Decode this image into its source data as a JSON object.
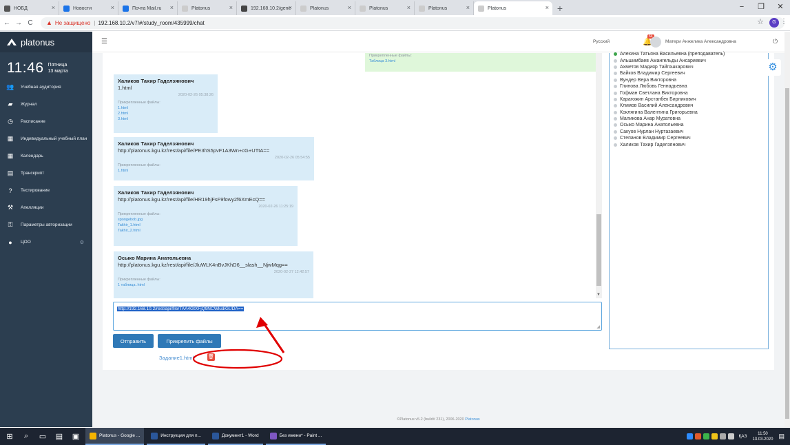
{
  "browser": {
    "tabs": [
      {
        "title": "НОБД",
        "color": "#555555"
      },
      {
        "title": "Новости",
        "color": "#1a73e8"
      },
      {
        "title": "Почта Mail.ru",
        "color": "#1a73e8"
      },
      {
        "title": "Platonus",
        "color": "#cccccc"
      },
      {
        "title": "192.168.10.2/generatr",
        "color": "#444444"
      },
      {
        "title": "Platonus",
        "color": "#cccccc"
      },
      {
        "title": "Platonus",
        "color": "#cccccc"
      },
      {
        "title": "Platonus",
        "color": "#cccccc"
      },
      {
        "title": "Platonus",
        "color": "#cccccc"
      }
    ],
    "new_tab": "+",
    "window_controls": {
      "minimize": "−",
      "maximize": "❐",
      "close": "✕"
    },
    "not_secure": "Не защищено",
    "url": "192.168.10.2/v7/#/study_room/435999/chat",
    "profile_initial": "G"
  },
  "sidebar": {
    "brand": "platonus",
    "time": "11:46",
    "weekday": "Пятница",
    "date": "13 марта",
    "items": [
      {
        "label": "Учебная аудитория",
        "icon": "people-icon"
      },
      {
        "label": "Журнал",
        "icon": "book-icon"
      },
      {
        "label": "Расписание",
        "icon": "clock-icon"
      },
      {
        "label": "Индивидуальный учебный план",
        "icon": "grid-icon"
      },
      {
        "label": "Календарь",
        "icon": "calendar-icon"
      },
      {
        "label": "Транскрипт",
        "icon": "table-icon"
      },
      {
        "label": "Тестирование",
        "icon": "question-icon"
      },
      {
        "label": "Апелляции",
        "icon": "gavel-icon"
      },
      {
        "label": "Параметры авторизации",
        "icon": "key-icon"
      },
      {
        "label": "ЦОО",
        "icon": "user-icon"
      }
    ]
  },
  "header": {
    "language": "Русский",
    "notifications": "64",
    "user": "Матери Анжелика Александровна"
  },
  "chat": {
    "messages": [
      {
        "author": "",
        "text": "",
        "timestamp": "",
        "attachments_label": "Прикрепленные файлы:",
        "files": [
          "Таблица 3.html"
        ],
        "green": true
      },
      {
        "author": "Халиков Тахир Гаделзянович",
        "text": "1.html",
        "timestamp": "2020-02-26 05:38:26",
        "attachments_label": "Прикрепленные файлы:",
        "files": [
          "1.html",
          "2.html",
          "3.html"
        ]
      },
      {
        "author": "Халиков Тахир Гаделзянович",
        "text": "http://platonus.kgu.kz/rest/api/file/PE3hS5pvF1A3Wn+cG+UTtA==",
        "timestamp": "2020-02-26 05:54:55",
        "attachments_label": "Прикрепленные файлы:",
        "files": [
          "1.html"
        ]
      },
      {
        "author": "Халиков Тахир Гаделзянович",
        "text": "http://platonus.kgu.kz/rest/api/file/HR19hjFsF9fowy2f6XmEcQ==",
        "timestamp": "2020-02-26 11:25:19",
        "attachments_label": "Прикрепленные файлы:",
        "files": [
          "spongebob.jpg",
          "Takhir_1.html",
          "Takhir_2.html"
        ]
      },
      {
        "author": "Осыко Марина Анатольевна",
        "text": "http://platonus.kgu.kz/rest/api/file/JluWLK4nBvJKhD6__slash__NjwMqg==",
        "timestamp": "2020-02-27 12:42:57",
        "attachments_label": "Прикрепленные файлы:",
        "files": [
          "1 таблица .html"
        ]
      }
    ],
    "input_value": "http://192.168.10.2/rest/api/file/TAA4GtXFjQ9NCWludiGUDA==",
    "send_label": "Отправить",
    "attach_label": "Прикрепить файлы",
    "attached_file": "Задание1.html"
  },
  "members": [
    {
      "name": "Алехина Татьяна Васильевна (преподаватель)",
      "online": true
    },
    {
      "name": "Альшимбаев Амангельды Ансариевич",
      "online": false
    },
    {
      "name": "Ахметов Мадияр Тайгошкарович",
      "online": false
    },
    {
      "name": "Байков Владимир Сергеевич",
      "online": false
    },
    {
      "name": "Вундер Вера Викторовна",
      "online": false
    },
    {
      "name": "Глинова Любовь Геннадьевна",
      "online": false
    },
    {
      "name": "Гофман Светлана Викторовна",
      "online": false
    },
    {
      "name": "Карагожин Арстанбек Бирликович",
      "online": false
    },
    {
      "name": "Климов Василий Александрович",
      "online": false
    },
    {
      "name": "Коклягина Валентина Григорьевна",
      "online": false
    },
    {
      "name": "Маликова Анар Муратовна",
      "online": false
    },
    {
      "name": "Осыко Марина Анатольевна",
      "online": false
    },
    {
      "name": "Сакуов Нурлан Нуртазаевич",
      "online": false
    },
    {
      "name": "Степанов Владимир Сергеевич",
      "online": false
    },
    {
      "name": "Халиков Тахир Гаделзянович",
      "online": false
    }
  ],
  "footer": {
    "text": "©Platonus v5.2 (build# 231), 2006-2020",
    "link": "Platonus"
  },
  "taskbar": {
    "apps": [
      {
        "label": "Platonus - Google ...",
        "color": "#f4b400",
        "active": true
      },
      {
        "label": "Инструкция для п...",
        "color": "#2b579a",
        "active": false
      },
      {
        "label": "Документ1 - Word",
        "color": "#2b579a",
        "active": false
      },
      {
        "label": "Без имени* - Paint ...",
        "color": "#7e57c2",
        "active": false
      }
    ],
    "layout": "ҚАЗ",
    "time": "11:50",
    "date": "13.03.2020"
  },
  "colors": {
    "sidebar_bg": "#2c3e50",
    "accent": "#2f79b7",
    "bubble": "#d9ecf8",
    "annotation": "#e00000"
  }
}
